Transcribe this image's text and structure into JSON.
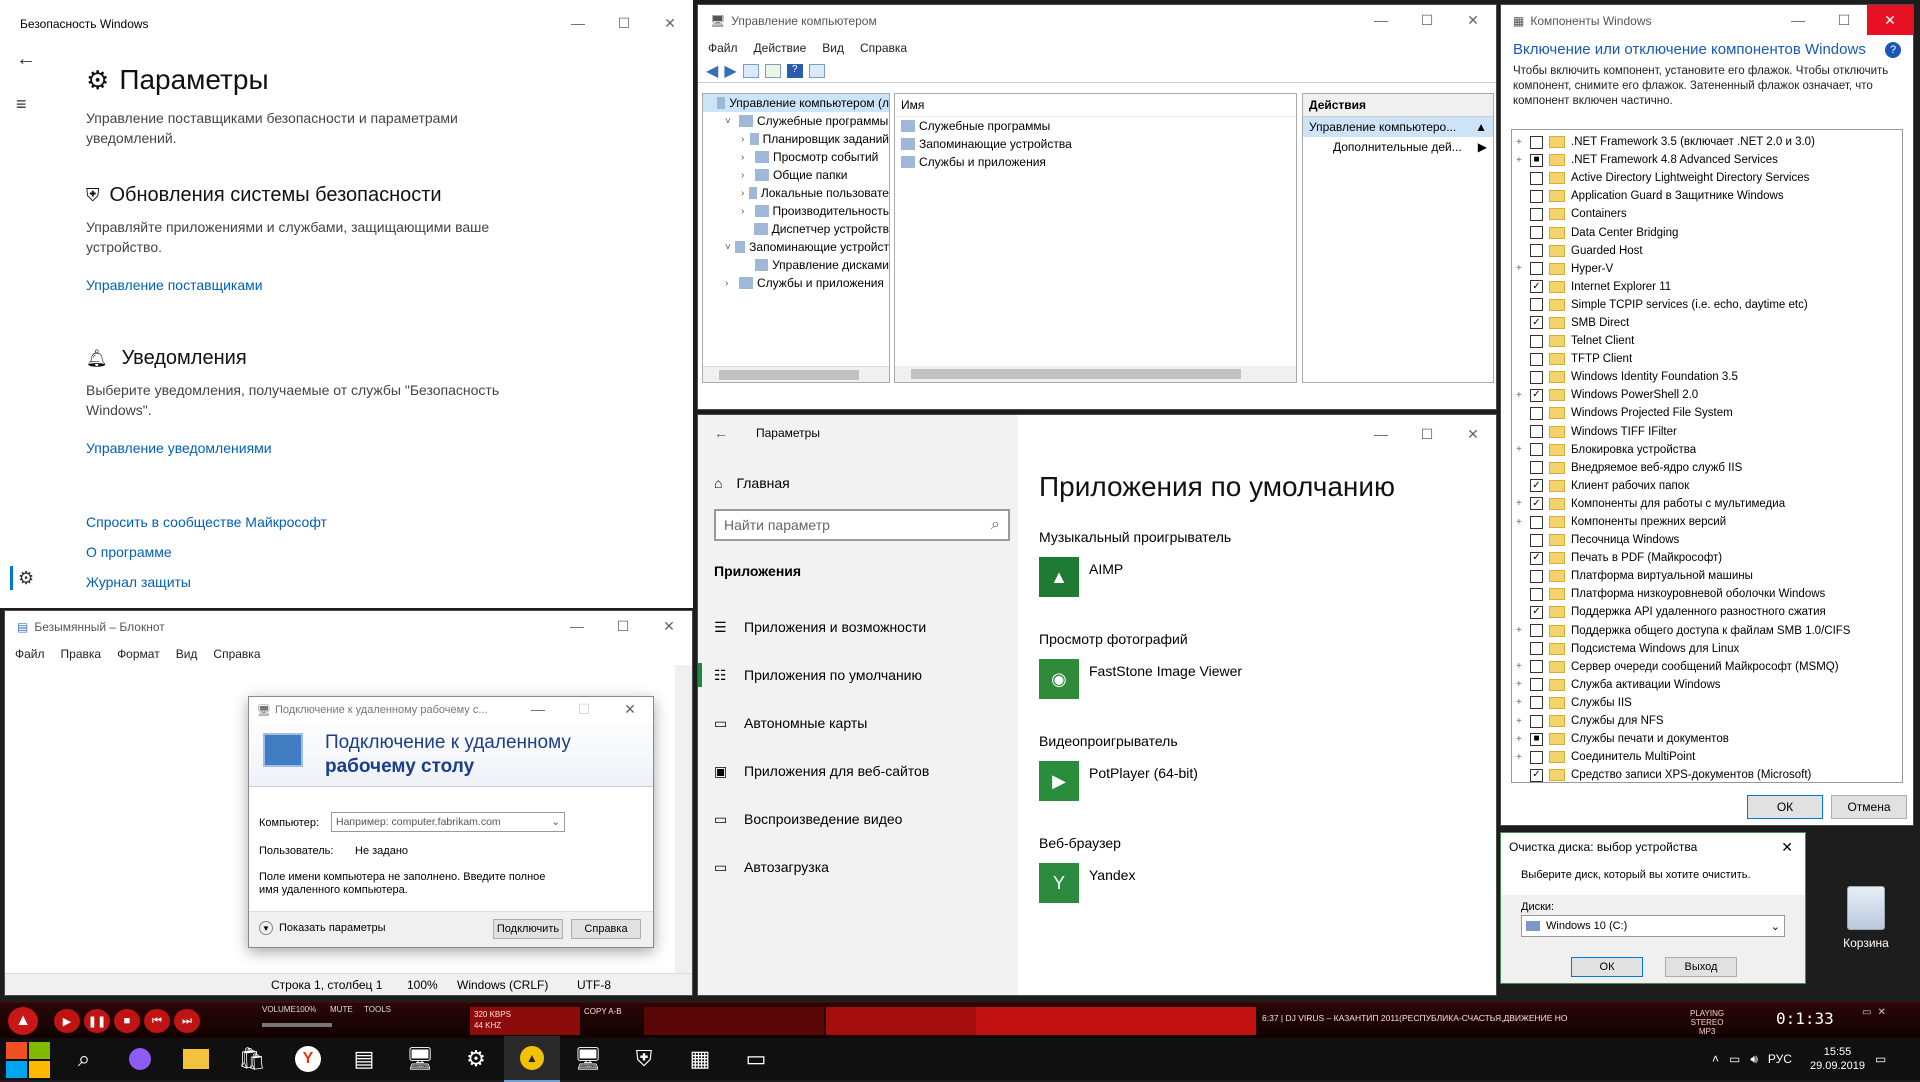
{
  "security": {
    "title": "Безопасность Windows",
    "heading": "Параметры",
    "desc": "Управление поставщиками безопасности и параметрами уведомлений.",
    "s1_title": "Обновления системы безопасности",
    "s1_desc": "Управляйте приложениями и службами, защищающими ваше устройство.",
    "s1_link": "Управление поставщиками",
    "s2_title": "Уведомления",
    "s2_desc": "Выберите уведомления, получаемые от службы \"Безопасность Windows\".",
    "s2_link": "Управление уведомлениями",
    "link_community": "Спросить в сообществе Майкрософт",
    "link_about": "О программе",
    "link_log": "Журнал защиты"
  },
  "compmgmt": {
    "title": "Управление компьютером",
    "menu": [
      "Файл",
      "Действие",
      "Вид",
      "Справка"
    ],
    "tree": [
      {
        "label": "Управление компьютером (л",
        "lvl": 0,
        "exp": ""
      },
      {
        "label": "Служебные программы",
        "lvl": 1,
        "exp": "˅"
      },
      {
        "label": "Планировщик заданий",
        "lvl": 2,
        "exp": "›"
      },
      {
        "label": "Просмотр событий",
        "lvl": 2,
        "exp": "›"
      },
      {
        "label": "Общие папки",
        "lvl": 2,
        "exp": "›"
      },
      {
        "label": "Локальные пользовате",
        "lvl": 2,
        "exp": "›"
      },
      {
        "label": "Производительность",
        "lvl": 2,
        "exp": "›"
      },
      {
        "label": "Диспетчер устройств",
        "lvl": 2,
        "exp": ""
      },
      {
        "label": "Запоминающие устройст",
        "lvl": 1,
        "exp": "˅"
      },
      {
        "label": "Управление дисками",
        "lvl": 2,
        "exp": ""
      },
      {
        "label": "Службы и приложения",
        "lvl": 1,
        "exp": "›"
      }
    ],
    "col_name": "Имя",
    "items": [
      "Служебные программы",
      "Запоминающие устройства",
      "Службы и приложения"
    ],
    "actions_title": "Действия",
    "actions_sel": "Управление компьютеро...",
    "actions_more": "Дополнительные дей..."
  },
  "features": {
    "title": "Компоненты Windows",
    "heading": "Включение или отключение компонентов Windows",
    "help": "?",
    "desc": "Чтобы включить компонент, установите его флажок. Чтобы отключить компонент, снимите его флажок. Затененный флажок означает, что компонент включен частично.",
    "items": [
      {
        "label": ".NET Framework 3.5 (включает .NET 2.0 и 3.0)",
        "exp": "+",
        "state": ""
      },
      {
        "label": ".NET Framework 4.8 Advanced Services",
        "exp": "+",
        "state": "■"
      },
      {
        "label": "Active Directory Lightweight Directory Services",
        "exp": "",
        "state": ""
      },
      {
        "label": "Application Guard в Защитнике Windows",
        "exp": "",
        "state": ""
      },
      {
        "label": "Containers",
        "exp": "",
        "state": ""
      },
      {
        "label": "Data Center Bridging",
        "exp": "",
        "state": ""
      },
      {
        "label": "Guarded Host",
        "exp": "",
        "state": ""
      },
      {
        "label": "Hyper-V",
        "exp": "+",
        "state": ""
      },
      {
        "label": "Internet Explorer 11",
        "exp": "",
        "state": "✓"
      },
      {
        "label": "Simple TCPIP services (i.e. echo, daytime etc)",
        "exp": "",
        "state": ""
      },
      {
        "label": "SMB Direct",
        "exp": "",
        "state": "✓"
      },
      {
        "label": "Telnet Client",
        "exp": "",
        "state": ""
      },
      {
        "label": "TFTP Client",
        "exp": "",
        "state": ""
      },
      {
        "label": "Windows Identity Foundation 3.5",
        "exp": "",
        "state": ""
      },
      {
        "label": "Windows PowerShell 2.0",
        "exp": "+",
        "state": "✓"
      },
      {
        "label": "Windows Projected File System",
        "exp": "",
        "state": ""
      },
      {
        "label": "Windows TIFF IFilter",
        "exp": "",
        "state": ""
      },
      {
        "label": "Блокировка устройства",
        "exp": "+",
        "state": ""
      },
      {
        "label": "Внедряемое веб-ядро служб IIS",
        "exp": "",
        "state": ""
      },
      {
        "label": "Клиент рабочих папок",
        "exp": "",
        "state": "✓"
      },
      {
        "label": "Компоненты для работы с мультимедиа",
        "exp": "+",
        "state": "✓"
      },
      {
        "label": "Компоненты прежних версий",
        "exp": "+",
        "state": ""
      },
      {
        "label": "Песочница Windows",
        "exp": "",
        "state": ""
      },
      {
        "label": "Печать в PDF (Майкрософт)",
        "exp": "",
        "state": "✓"
      },
      {
        "label": "Платформа виртуальной машины",
        "exp": "",
        "state": ""
      },
      {
        "label": "Платформа низкоуровневой оболочки Windows",
        "exp": "",
        "state": ""
      },
      {
        "label": "Поддержка API удаленного разностного сжатия",
        "exp": "",
        "state": "✓"
      },
      {
        "label": "Поддержка общего доступа к файлам SMB 1.0/CIFS",
        "exp": "+",
        "state": ""
      },
      {
        "label": "Подсистема Windows для Linux",
        "exp": "",
        "state": ""
      },
      {
        "label": "Сервер очереди сообщений Майкрософт (MSMQ)",
        "exp": "+",
        "state": ""
      },
      {
        "label": "Служба активации Windows",
        "exp": "+",
        "state": ""
      },
      {
        "label": "Службы IIS",
        "exp": "+",
        "state": ""
      },
      {
        "label": "Службы для NFS",
        "exp": "+",
        "state": ""
      },
      {
        "label": "Службы печати и документов",
        "exp": "+",
        "state": "■"
      },
      {
        "label": "Соединитель MultiPoint",
        "exp": "+",
        "state": ""
      },
      {
        "label": "Средство записи XPS-документов (Microsoft)",
        "exp": "",
        "state": "✓"
      }
    ],
    "ok": "ОК",
    "cancel": "Отмена"
  },
  "settings": {
    "title": "Параметры",
    "home": "Главная",
    "search_placeholder": "Найти параметр",
    "section": "Приложения",
    "nav": [
      {
        "label": "Приложения и возможности",
        "icon": "☰"
      },
      {
        "label": "Приложения по умолчанию",
        "icon": "☷"
      },
      {
        "label": "Автономные карты",
        "icon": "▭"
      },
      {
        "label": "Приложения для веб-сайтов",
        "icon": "▣"
      },
      {
        "label": "Воспроизведение видео",
        "icon": "▭"
      },
      {
        "label": "Автозагрузка",
        "icon": "▭"
      }
    ],
    "page_title": "Приложения по умолчанию",
    "groups": [
      {
        "label": "Музыкальный проигрыватель",
        "app": "AIMP",
        "color": "#1f7a33",
        "glyph": "▲"
      },
      {
        "label": "Просмотр фотографий",
        "app": "FastStone Image Viewer",
        "color": "#2f8a3a",
        "glyph": "◉"
      },
      {
        "label": "Видеопроигрыватель",
        "app": "PotPlayer (64-bit)",
        "color": "#2a8d3e",
        "glyph": "▶"
      },
      {
        "label": "Веб-браузер",
        "app": "Yandex",
        "color": "#2b8a3d",
        "glyph": "Y"
      }
    ]
  },
  "notepad": {
    "title": "Безымянный – Блокнот",
    "menu": [
      "Файл",
      "Правка",
      "Формат",
      "Вид",
      "Справка"
    ],
    "status": [
      "Строка 1, столбец 1",
      "100%",
      "Windows (CRLF)",
      "UTF-8"
    ]
  },
  "rdp": {
    "title": "Подключение к удаленному рабочему с...",
    "heading1": "Подключение к удаленному",
    "heading2": "рабочему столу",
    "label_computer": "Компьютер:",
    "computer_placeholder": "Например: computer.fabrikam.com",
    "label_user": "Пользователь:",
    "user_value": "Не задано",
    "note": "Поле имени компьютера не заполнено. Введите полное имя удаленного компьютера.",
    "show_params": "Показать параметры",
    "connect": "Подключить",
    "help": "Справка"
  },
  "diskclean": {
    "title": "Очистка диска: выбор устройства",
    "prompt": "Выберите диск, который вы хотите очистить.",
    "label_drives": "Диски:",
    "drive_value": "Windows 10 (C:)",
    "ok": "ОК",
    "exit": "Выход"
  },
  "desktop": {
    "recycle_label": "Корзина"
  },
  "aimp": {
    "labels": [
      "VOLUME100%",
      "MUTE",
      "TOOLS"
    ],
    "kbps": "320 KBPS",
    "khz": "44 KHZ",
    "copy": "COPY A-B",
    "track": "6:37 | DJ VIRUS – КАЗАНТИП 2011(РЕСПУБЛИКА-СЧАСТЬЯ,ДВИЖЕНИЕ НО",
    "status": "PLAYING",
    "stereo": "STEREO",
    "mp3": "MP3",
    "time": "0:1:33"
  },
  "taskbar": {
    "lang": "РУС",
    "time": "15:55",
    "date": "29.09.2019"
  }
}
